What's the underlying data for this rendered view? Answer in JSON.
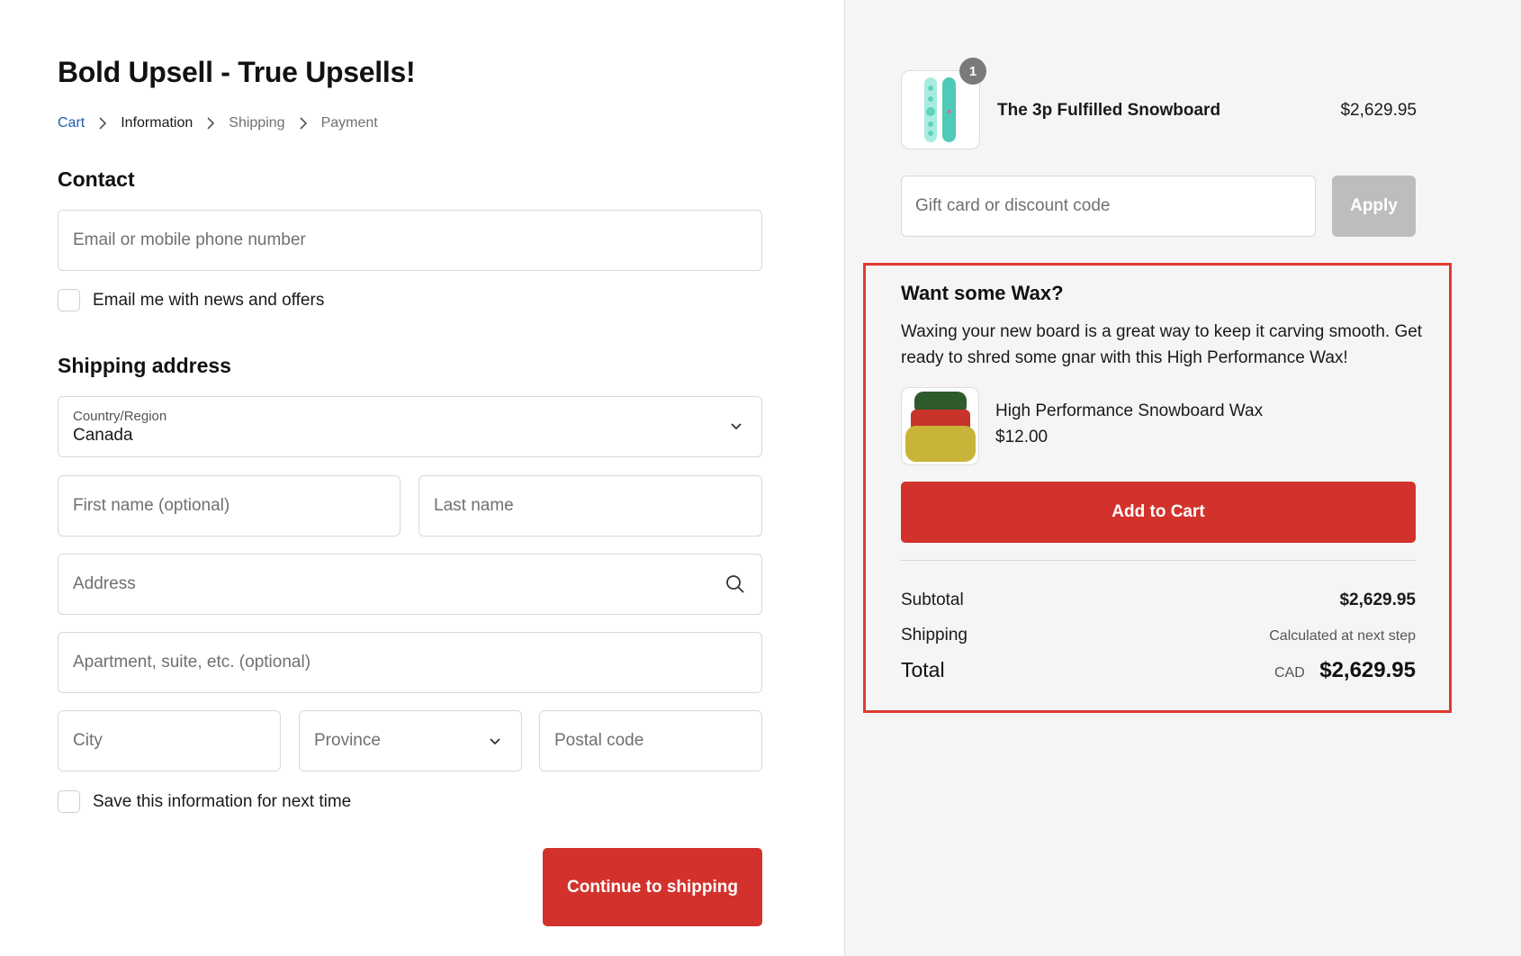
{
  "store": {
    "title": "Bold Upsell - True Upsells!"
  },
  "breadcrumb": {
    "items": [
      {
        "label": "Cart"
      },
      {
        "label": "Information"
      },
      {
        "label": "Shipping"
      },
      {
        "label": "Payment"
      }
    ]
  },
  "contact": {
    "heading": "Contact",
    "email_placeholder": "Email or mobile phone number",
    "news_checkbox_label": "Email me with news and offers"
  },
  "shipping": {
    "heading": "Shipping address",
    "country_label": "Country/Region",
    "country_value": "Canada",
    "first_name_placeholder": "First name (optional)",
    "last_name_placeholder": "Last name",
    "address_placeholder": "Address",
    "apartment_placeholder": "Apartment, suite, etc. (optional)",
    "city_placeholder": "City",
    "province_placeholder": "Province",
    "postal_placeholder": "Postal code",
    "save_checkbox_label": "Save this information for next time",
    "continue_label": "Continue to shipping"
  },
  "cart": {
    "product_name": "The 3p Fulfilled Snowboard",
    "product_price": "$2,629.95",
    "quantity": "1",
    "discount_placeholder": "Gift card or discount code",
    "apply_label": "Apply"
  },
  "upsell": {
    "title": "Want some Wax?",
    "description": "Waxing your new board is a great way to keep it carving smooth. Get ready to shred some gnar with this High Performance Wax!",
    "product_name": "High Performance Snowboard Wax",
    "product_price": "$12.00",
    "add_label": "Add to Cart"
  },
  "summary": {
    "subtotal_label": "Subtotal",
    "subtotal_value": "$2,629.95",
    "shipping_label": "Shipping",
    "shipping_value": "Calculated at next step",
    "total_label": "Total",
    "currency": "CAD",
    "total_value": "$2,629.95"
  },
  "colors": {
    "accent": "#d3322c",
    "link": "#1f5fa8",
    "highlight_border": "#e03a2f"
  }
}
